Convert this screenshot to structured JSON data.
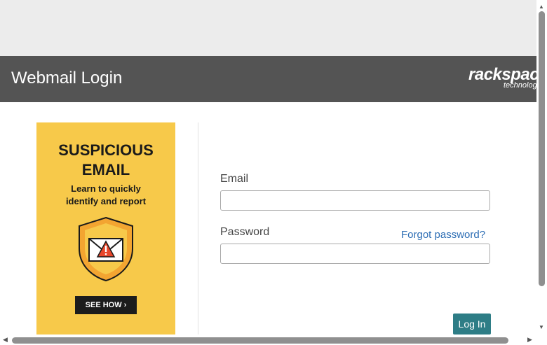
{
  "header": {
    "title": "Webmail Login",
    "logo_line1": "rackspace",
    "logo_line2": "technology"
  },
  "ad": {
    "headline1": "SUSPICIOUS",
    "headline2": "EMAIL",
    "subline1": "Learn to quickly",
    "subline2": "identify and report",
    "cta": "SEE HOW ›",
    "shield_icon": "shield-warning-envelope-icon"
  },
  "form": {
    "email_label": "Email",
    "email_value": "",
    "password_label": "Password",
    "password_value": "",
    "forgot_link": "Forgot password?",
    "login_button": "Log In"
  },
  "colors": {
    "header_bg": "#545454",
    "ad_bg": "#f7c94a",
    "button_bg": "#2e7d86",
    "link": "#2c6db4"
  }
}
